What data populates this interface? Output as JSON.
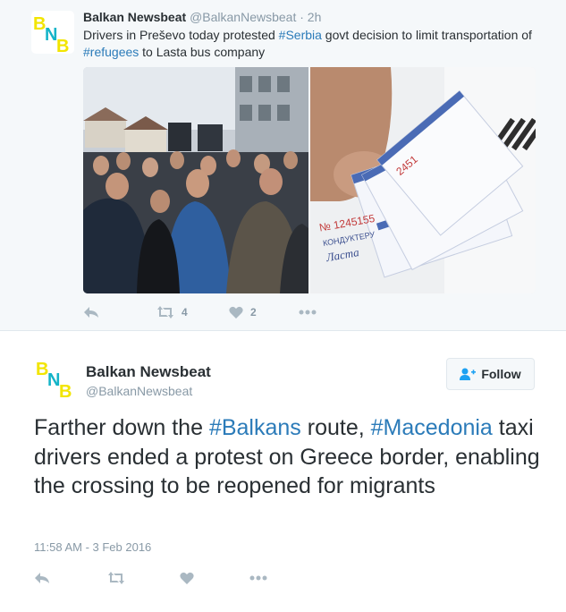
{
  "quoted_tweet": {
    "author_name": "Balkan Newsbeat",
    "handle": "@BalkanNewsbeat",
    "time": "2h",
    "separator": " · ",
    "text_part1": "Drivers in Preševo today protested ",
    "hashtag1": "#Serbia",
    "text_part2": " govt decision to limit transportation of ",
    "hashtag2": "#refugees",
    "text_part3": " to Lasta bus company",
    "retweet_count": "4",
    "like_count": "2",
    "avatar_letters": [
      "B",
      "N",
      "B"
    ],
    "ticket_text": {
      "ticket_no": "№ 1245155",
      "ticket_no_2": "2451",
      "conductor": "КОНДУКТЕРУ",
      "brand": "Ласта"
    }
  },
  "main_tweet": {
    "author_name": "Balkan Newsbeat",
    "handle": "@BalkanNewsbeat",
    "follow_label": "Follow",
    "text_part1": "Farther down the ",
    "hashtag1": "#Balkans",
    "text_part2": " route, ",
    "hashtag2": "#Macedonia",
    "text_part3": " taxi drivers ended a protest on Greece border, enabling the crossing to be reopened for migrants",
    "timestamp": "11:58 AM - 3 Feb 2016"
  },
  "colors": {
    "hashtag": "#2b7bb9",
    "muted": "#8899a6",
    "text": "#292f33",
    "logo_yellow": "#f2e500",
    "logo_teal": "#14b4c8",
    "background_quoted": "#f5f8fa"
  },
  "icons": [
    "reply-icon",
    "retweet-icon",
    "heart-icon",
    "more-icon",
    "follow-user-icon"
  ]
}
